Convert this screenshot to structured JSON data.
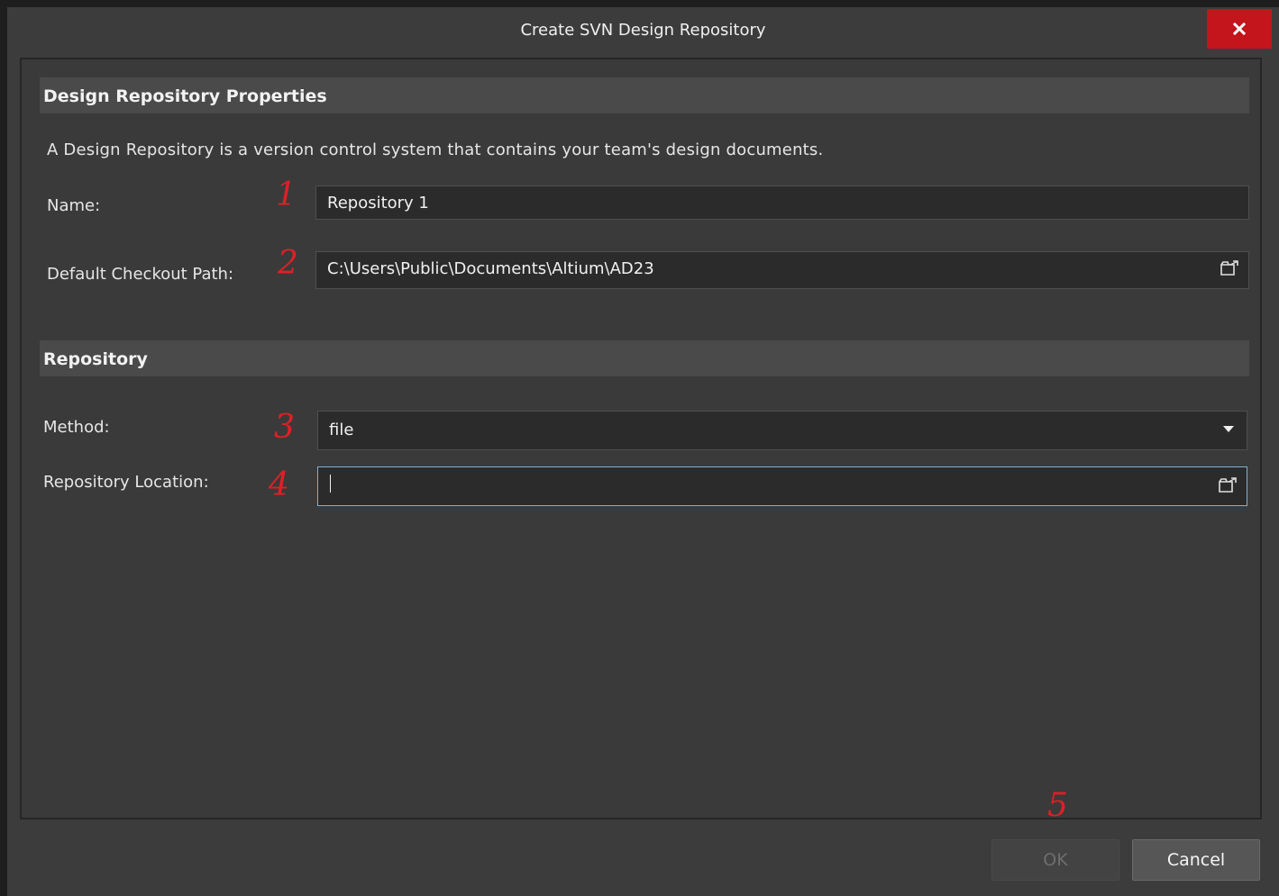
{
  "dialog": {
    "title": "Create SVN Design Repository"
  },
  "properties": {
    "header": "Design Repository Properties",
    "description": "A Design Repository is a version control system that contains your team's design documents.",
    "name_label": "Name:",
    "name_value": "Repository 1",
    "checkout_label": "Default Checkout Path:",
    "checkout_value": "C:\\Users\\Public\\Documents\\Altium\\AD23"
  },
  "repository": {
    "header": "Repository",
    "method_label": "Method:",
    "method_value": "file",
    "location_label": "Repository Location:",
    "location_value": ""
  },
  "annotations": [
    "1",
    "2",
    "3",
    "4",
    "5"
  ],
  "buttons": {
    "ok": "OK",
    "cancel": "Cancel"
  },
  "colors": {
    "close_button": "#c4151c",
    "annotation_red": "#e01f26",
    "focus_border": "#7fb0d6"
  },
  "icons": {
    "close": "close-icon",
    "folder": "folder-browse-icon",
    "dropdown": "chevron-down-icon"
  }
}
